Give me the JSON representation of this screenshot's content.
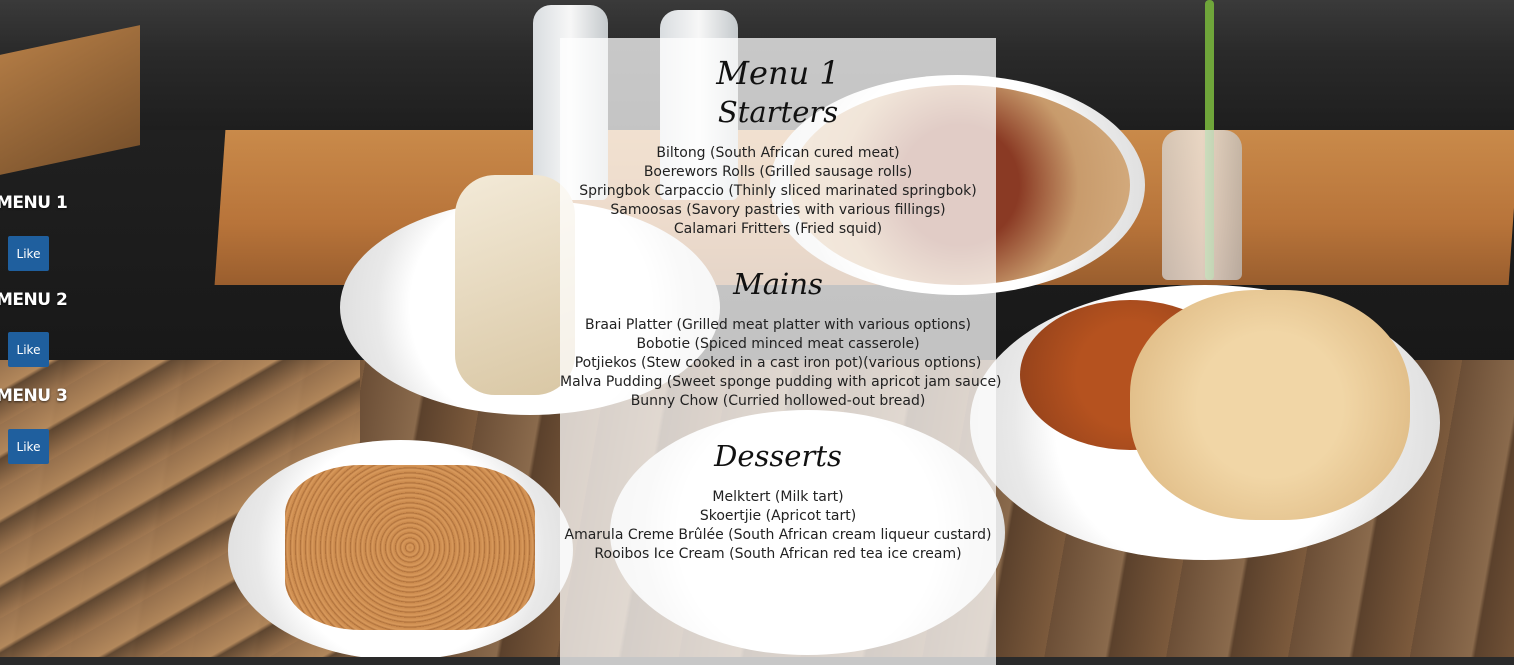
{
  "sidebar": {
    "items": [
      {
        "label": "MENU 1",
        "like_label": "Like"
      },
      {
        "label": "MENU 2",
        "like_label": "Like"
      },
      {
        "label": "MENU 3",
        "like_label": "Like"
      }
    ]
  },
  "menu": {
    "title": "Menu 1",
    "sections": [
      {
        "title": "Starters",
        "items": [
          "Biltong (South African cured meat)",
          "Boerewors Rolls (Grilled sausage rolls)",
          "Springbok Carpaccio (Thinly sliced marinated springbok)",
          "Samoosas (Savory pastries with various fillings)",
          "Calamari Fritters (Fried squid)"
        ]
      },
      {
        "title": "Mains",
        "items": [
          "Braai Platter (Grilled meat platter with various options)",
          "Bobotie (Spiced minced meat casserole)",
          "Potjiekos (Stew cooked in a cast iron pot)(various options)",
          "Malva Pudding (Sweet sponge pudding with apricot jam sauce)",
          "Bunny Chow (Curried hollowed-out bread)"
        ]
      },
      {
        "title": "Desserts",
        "items": [
          "Melktert (Milk tart)",
          "Skoertjie (Apricot tart)",
          "Amarula Creme Brûlée (South African cream liqueur custard)",
          "Rooibos Ice Cream (South African red tea ice cream)"
        ]
      }
    ]
  },
  "colors": {
    "like_button": "#1f5f9e",
    "panel_overlay": "rgba(255,255,255,0.74)"
  }
}
